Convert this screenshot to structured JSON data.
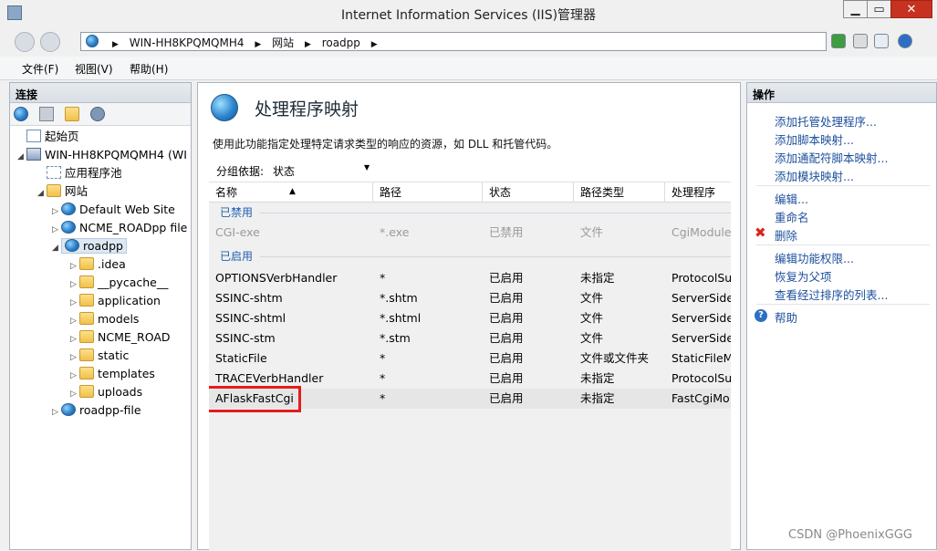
{
  "window": {
    "title": "Internet Information Services (IIS)管理器",
    "min": "▁",
    "max": "▭",
    "close": "✕"
  },
  "address": {
    "crumbs": [
      "WIN-HH8KPQMQMH4",
      "网站",
      "roadpp"
    ],
    "sep": "▶"
  },
  "menu": [
    "文件(F)",
    "视图(V)",
    "帮助(H)"
  ],
  "left": {
    "header": "连接",
    "tree": [
      {
        "label": "起始页",
        "icon": "start-page-icon",
        "expander": ""
      },
      {
        "label": "WIN-HH8KPQMQMH4 (WI",
        "icon": "server-icon",
        "expander": "◢"
      },
      {
        "label": "应用程序池",
        "icon": "app-pool-icon",
        "expander": ""
      },
      {
        "label": "网站",
        "icon": "folder-icon",
        "expander": "◢"
      },
      {
        "label": "Default Web Site",
        "icon": "globe-icon",
        "expander": "▷"
      },
      {
        "label": "NCME_ROADpp file",
        "icon": "globe-icon",
        "expander": "▷"
      },
      {
        "label": "roadpp",
        "icon": "globe-icon",
        "expander": "◢"
      },
      {
        "label": ".idea",
        "icon": "folder-icon",
        "expander": "▷"
      },
      {
        "label": "__pycache__",
        "icon": "folder-icon",
        "expander": "▷"
      },
      {
        "label": "application",
        "icon": "folder-icon",
        "expander": "▷"
      },
      {
        "label": "models",
        "icon": "folder-icon",
        "expander": "▷"
      },
      {
        "label": "NCME_ROAD",
        "icon": "folder-icon",
        "expander": "▷"
      },
      {
        "label": "static",
        "icon": "folder-icon",
        "expander": "▷"
      },
      {
        "label": "templates",
        "icon": "folder-icon",
        "expander": "▷"
      },
      {
        "label": "uploads",
        "icon": "folder-icon",
        "expander": "▷"
      },
      {
        "label": "roadpp-file",
        "icon": "globe-icon",
        "expander": "▷"
      }
    ]
  },
  "center": {
    "title": "处理程序映射",
    "description": "使用此功能指定处理特定请求类型的响应的资源，如 DLL 和托管代码。",
    "groupby_label": "分组依据:",
    "groupby_value": "状态",
    "groupby_arrow": "▼",
    "sort_arrow": "▲",
    "columns": [
      "名称",
      "路径",
      "状态",
      "路径类型",
      "处理程序"
    ],
    "groups": [
      {
        "label": "已禁用",
        "rows": [
          [
            "CGI-exe",
            "*.exe",
            "已禁用",
            "文件",
            "CgiModule"
          ]
        ]
      },
      {
        "label": "已启用",
        "rows": [
          [
            "OPTIONSVerbHandler",
            "*",
            "已启用",
            "未指定",
            "ProtocolSu"
          ],
          [
            "SSINC-shtm",
            "*.shtm",
            "已启用",
            "文件",
            "ServerSide"
          ],
          [
            "SSINC-shtml",
            "*.shtml",
            "已启用",
            "文件",
            "ServerSide"
          ],
          [
            "SSINC-stm",
            "*.stm",
            "已启用",
            "文件",
            "ServerSide"
          ],
          [
            "StaticFile",
            "*",
            "已启用",
            "文件或文件夹",
            "StaticFileM"
          ],
          [
            "TRACEVerbHandler",
            "*",
            "已启用",
            "未指定",
            "ProtocolSu"
          ],
          [
            "AFlaskFastCgi",
            "*",
            "已启用",
            "未指定",
            "FastCgiMo"
          ]
        ]
      }
    ]
  },
  "right": {
    "header": "操作",
    "actions_add": [
      "添加托管处理程序...",
      "添加脚本映射...",
      "添加通配符脚本映射...",
      "添加模块映射..."
    ],
    "actions_edit": [
      "编辑...",
      "重命名",
      "删除"
    ],
    "actions_perm": [
      "编辑功能权限...",
      "恢复为父项",
      "查看经过排序的列表..."
    ],
    "help": "帮助",
    "del_glyph": "✖",
    "help_glyph": "?"
  },
  "watermark": "CSDN @PhoenixGGG"
}
